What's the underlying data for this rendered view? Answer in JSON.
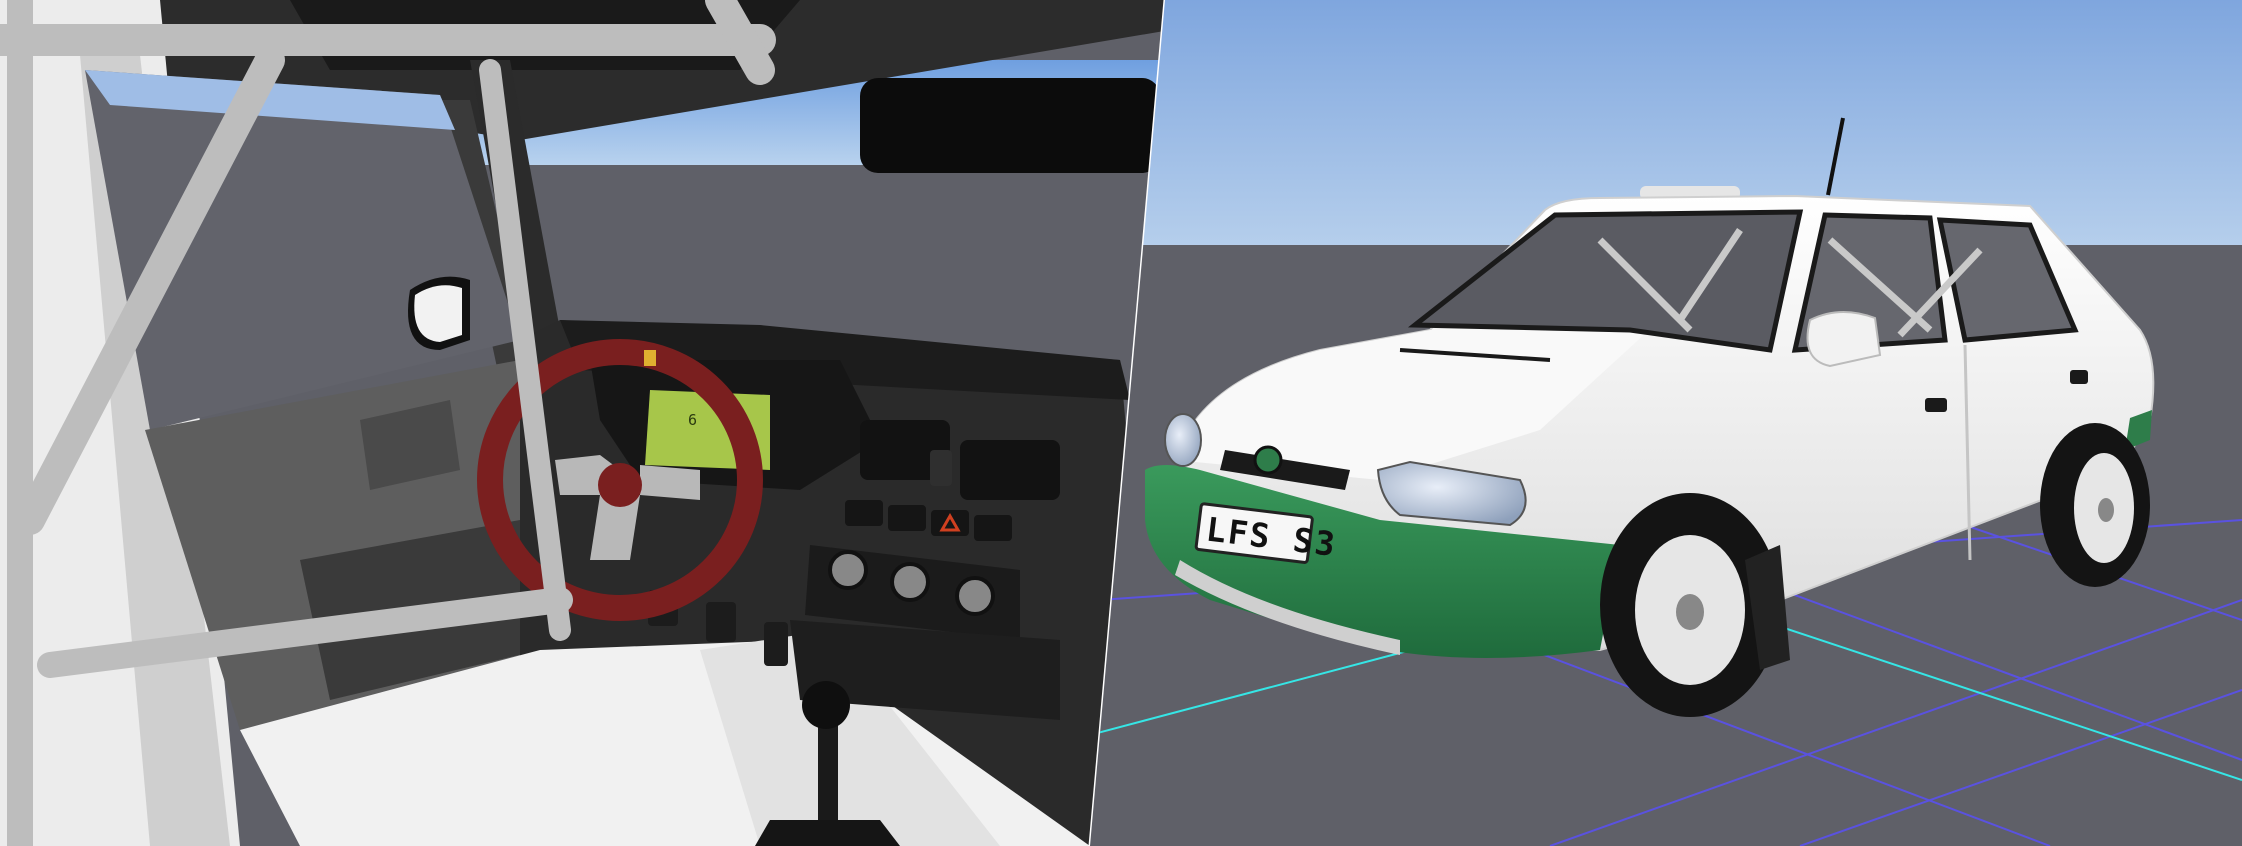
{
  "scene": {
    "left_view": "car-interior",
    "right_view": "car-exterior"
  },
  "car": {
    "plate_text": "LFS S3",
    "body_color": "#f4f4f4",
    "accent_color": "#2e7d4a",
    "wheel_color": "#e6e6e6"
  },
  "dashboard": {
    "display_color": "#a7c64a",
    "display_digits": "6"
  },
  "environment": {
    "sky_color": "#9fc0e8",
    "ground_color": "#5f6068",
    "grid_color": "#5a52e0",
    "grid_axis_color": "#35e6e6"
  }
}
